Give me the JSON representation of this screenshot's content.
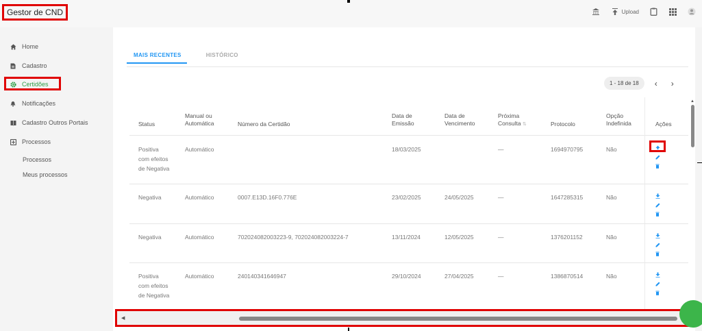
{
  "app": {
    "title": "Gestor de CND"
  },
  "topbar": {
    "upload_label": "Upload",
    "icons": [
      "bank-icon",
      "upload-icon",
      "clipboard-icon",
      "apps-grid-icon",
      "user-icon"
    ]
  },
  "sidebar": {
    "items": [
      {
        "label": "Home",
        "icon": "home-icon"
      },
      {
        "label": "Cadastro",
        "icon": "document-icon"
      },
      {
        "label": "Certidões",
        "icon": "gear-icon",
        "active": true
      },
      {
        "label": "Notificações",
        "icon": "notification-icon"
      },
      {
        "label": "Cadastro Outros Portais",
        "icon": "book-icon"
      },
      {
        "label": "Processos",
        "icon": "process-icon"
      }
    ],
    "subitems": [
      "Processos",
      "Meus processos"
    ]
  },
  "tabs": [
    {
      "label": "MAIS RECENTES",
      "active": true
    },
    {
      "label": "HISTÓRICO",
      "active": false
    }
  ],
  "pager": {
    "range": "1 - 18 de 18",
    "prev": "‹",
    "next": "›"
  },
  "table": {
    "headers": {
      "status": "Status",
      "manual_1": "Manual ou",
      "manual_2": "Automática",
      "numero": "Número da Certidão",
      "emissao_1": "Data de",
      "emissao_2": "Emissão",
      "venc_1": "Data de",
      "venc_2": "Vencimento",
      "prox_1": "Próxima",
      "prox_2": "Consulta",
      "protocolo": "Protocolo",
      "opcao_1": "Opção",
      "opcao_2": "Indefinida",
      "acoes": "Ações"
    },
    "rows": [
      {
        "status": "Positiva com efeitos de Negativa",
        "tipo": "Automático",
        "numero": "",
        "emissao": "18/03/2025",
        "vencimento": "",
        "proxima": "—",
        "protocolo": "1694970795",
        "opcao": "Não"
      },
      {
        "status": "Negativa",
        "tipo": "Automático",
        "numero": "0007.E13D.16F0.776E",
        "emissao": "23/02/2025",
        "vencimento": "24/05/2025",
        "proxima": "—",
        "protocolo": "1647285315",
        "opcao": "Não"
      },
      {
        "status": "Negativa",
        "tipo": "Automático",
        "numero": "702024082003223-9, 702024082003224-7",
        "emissao": "13/11/2024",
        "vencimento": "12/05/2025",
        "proxima": "—",
        "protocolo": "1376201152",
        "opcao": "Não"
      },
      {
        "status": "Positiva com efeitos de Negativa",
        "tipo": "Automático",
        "numero": "240140341646947",
        "emissao": "29/10/2024",
        "vencimento": "27/04/2025",
        "proxima": "—",
        "protocolo": "1386870514",
        "opcao": "Não"
      }
    ]
  },
  "colors": {
    "accent": "#2196f3",
    "active_nav": "#2e9e47",
    "highlight": "#e00000",
    "fab": "#3cb54a"
  }
}
